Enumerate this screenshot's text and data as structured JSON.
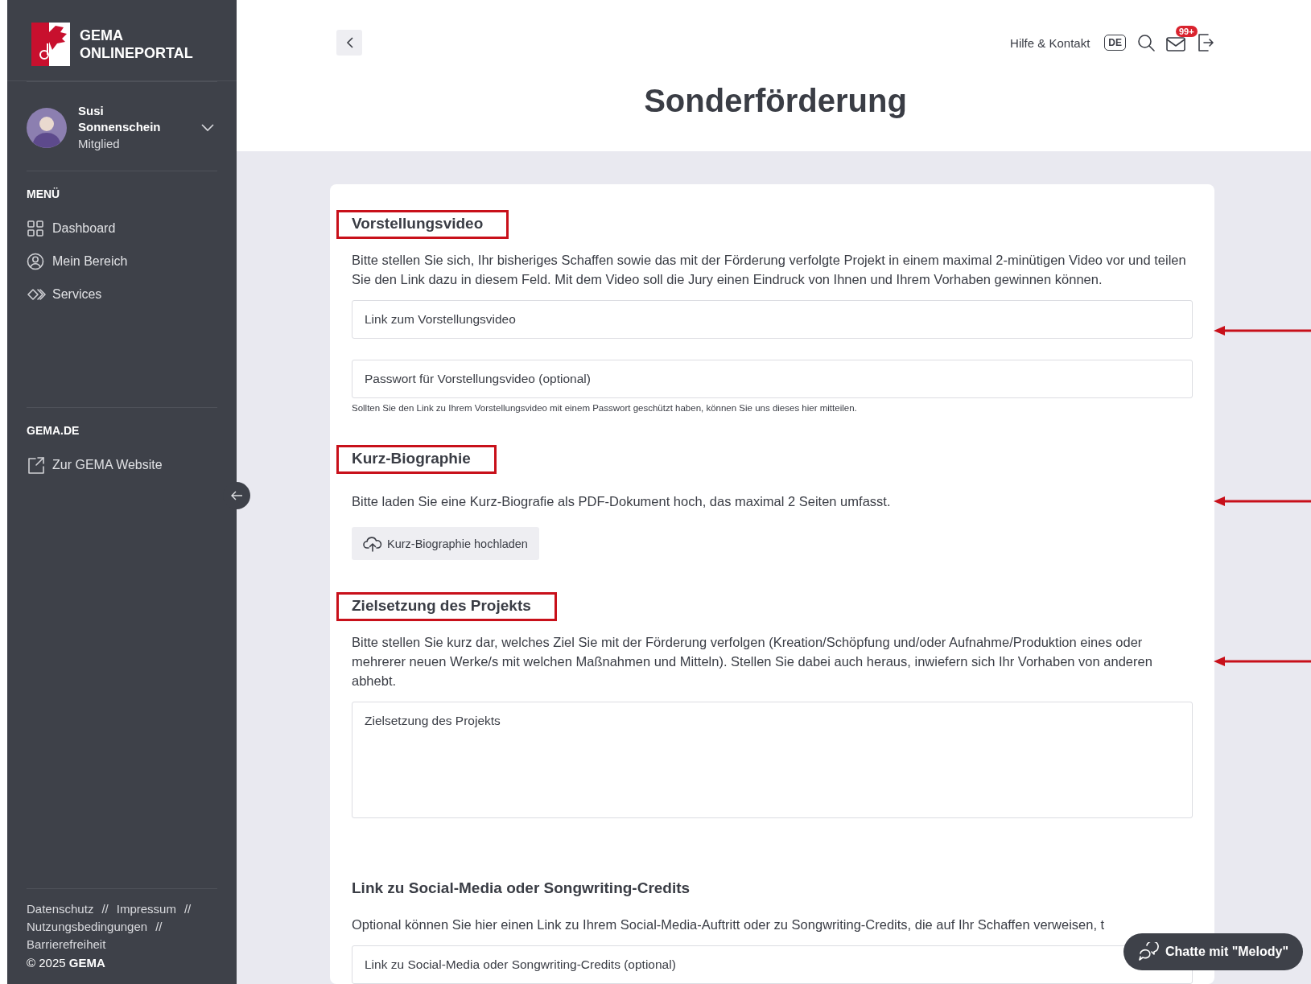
{
  "sidebar": {
    "logo_lines": [
      "GEMA",
      "ONLINEPORTAL"
    ],
    "user": {
      "name": "Susi Sonnenschein",
      "role": "Mitglied"
    },
    "menu_heading": "MENÜ",
    "menu_items": [
      {
        "label": "Dashboard",
        "selected": false
      },
      {
        "label": "Mein Bereich",
        "selected": false
      },
      {
        "label": "Services",
        "selected": false
      }
    ],
    "links_heading": "GEMA.DE",
    "links": [
      {
        "label": "Zur GEMA Website"
      }
    ],
    "footer_links": [
      "Datenschutz",
      "Impressum",
      "Nutzungsbedingungen",
      "Barrierefreiheit"
    ],
    "footer_separator": "//",
    "copyright": "© 2025 **GEMA**"
  },
  "header": {
    "help": "Hilfe & Kontakt",
    "language": "DE",
    "inbox_badge": "99+"
  },
  "title": "Sonderförderung",
  "sections": [
    {
      "heading": "Vorstellungsvideo",
      "highlighted": true,
      "arrow": true,
      "description": "Bitte stellen Sie sich, Ihr bisheriges Schaffen sowie das mit der Förderung verfolgte Projekt in einem maximal 2-minütigen Video vor und teilen Sie den Link dazu in diesem Feld. Mit dem Video soll die Jury einen Eindruck von Ihnen und Ihrem Vorhaben gewinnen können.",
      "fields": [
        {
          "kind": "input",
          "placeholder": "Link zum Vorstellungsvideo"
        },
        {
          "kind": "input",
          "placeholder": "Passwort für Vorstellungsvideo (optional)",
          "hint": "Sollten Sie den Link zu Ihrem Vorstellungsvideo mit einem Passwort geschützt haben, können Sie uns dieses hier mitteilen."
        }
      ]
    },
    {
      "heading": "Kurz-Biographie",
      "highlighted": true,
      "arrow": true,
      "description": "Bitte laden Sie eine Kurz-Biografie als PDF-Dokument hoch, das maximal 2 Seiten umfasst.",
      "fields": [
        {
          "kind": "upload",
          "label": "Kurz-Biographie hochladen"
        }
      ]
    },
    {
      "heading": "Zielsetzung des Projekts",
      "highlighted": true,
      "arrow": true,
      "description": "Bitte stellen Sie kurz dar, welches Ziel Sie mit der Förderung verfolgen (Kreation/Schöpfung und/oder Aufnahme/Produktion eines oder mehrerer neuen Werke/s mit welchen Maßnahmen und Mitteln). Stellen Sie dabei auch heraus, inwiefern sich Ihr Vorhaben von anderen abhebt.",
      "fields": [
        {
          "kind": "textarea",
          "placeholder": "Zielsetzung des Projekts"
        }
      ]
    },
    {
      "heading": "Link zu Social-Media oder Songwriting-Credits",
      "highlighted": false,
      "arrow": false,
      "description": "Optional können Sie hier einen Link zu Ihrem Social-Media-Auftritt oder zu Songwriting-Credits, die auf Ihr Schaffen verweisen, t",
      "fields": [
        {
          "kind": "input",
          "placeholder": "Link zu Social-Media oder Songwriting-Credits (optional)"
        }
      ]
    }
  ],
  "chat_button": "Chatte mit \"Melody\""
}
